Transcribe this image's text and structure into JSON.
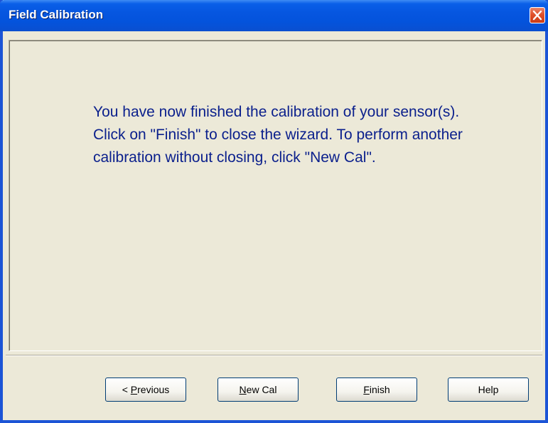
{
  "window": {
    "title": "Field Calibration"
  },
  "content": {
    "message": "You have now finished the calibration of your sensor(s). Click on \"Finish\" to close the wizard. To perform another calibration without closing, click \"New Cal\"."
  },
  "buttons": {
    "previous": {
      "prefix": "< ",
      "mnemonic": "P",
      "rest": "revious"
    },
    "new_cal": {
      "prefix": "",
      "mnemonic": "N",
      "rest": "ew Cal"
    },
    "finish": {
      "prefix": "",
      "mnemonic": "F",
      "rest": "inish"
    },
    "help": {
      "label": "Help"
    }
  },
  "icons": {
    "close": "close-icon"
  },
  "colors": {
    "titlebar": "#0453dc",
    "window_bg": "#ece9d8",
    "message_text": "#0a1f8c",
    "close_button": "#e0512b"
  }
}
